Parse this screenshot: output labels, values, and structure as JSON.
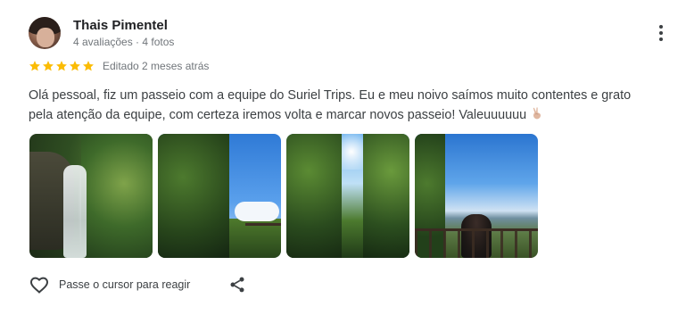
{
  "reviewer": {
    "name": "Thais Pimentel",
    "meta": "4 avaliações · 4 fotos"
  },
  "rating": {
    "stars": 5,
    "max_stars": 5,
    "edited": "Editado 2 meses atrás",
    "star_color": "#fbbc04"
  },
  "review": {
    "text": "Olá pessoal, fiz um passeio com a equipe do Suriel Trips. Eu e meu noivo saímos muito contentes e grato pela atenção da equipe, com certeza iremos volta e marcar novos passeio! Valeuuuuuu",
    "emoji": "victory-hand"
  },
  "photos": [
    {
      "subject": "waterfall"
    },
    {
      "subject": "forest-sky-view"
    },
    {
      "subject": "canopy-sunlight"
    },
    {
      "subject": "couple-at-viewpoint"
    }
  ],
  "actions": {
    "react_label": "Passe o cursor para reagir",
    "react_icon": "heart-outline-icon",
    "share_icon": "share-icon",
    "more_icon": "more-vertical-icon"
  }
}
